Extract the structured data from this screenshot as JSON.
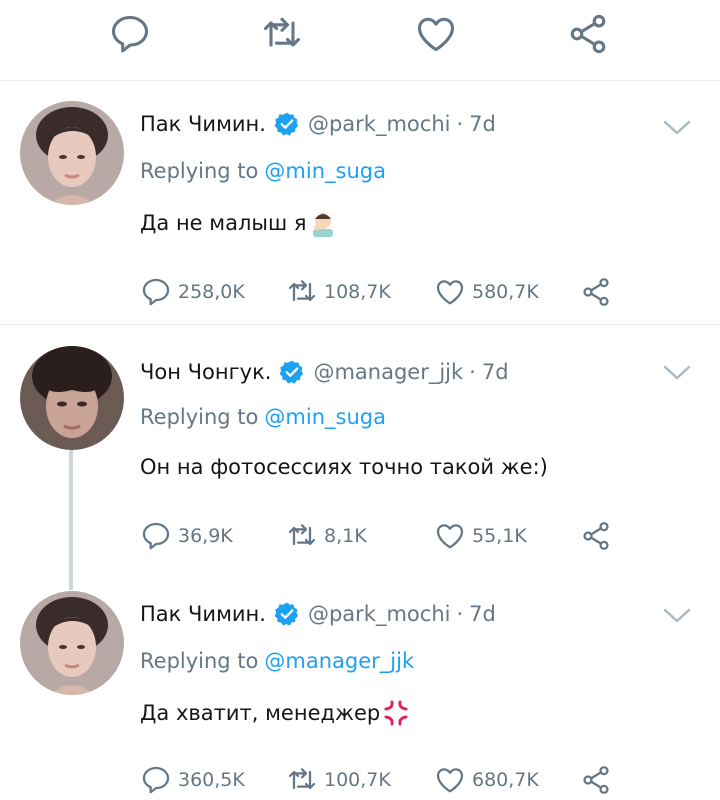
{
  "colors": {
    "accent": "#1da1f2",
    "icon": "#657786",
    "divider": "#e6ecf0",
    "thread": "#ccd6dd"
  },
  "top_actions": [
    "reply-icon",
    "retweet-icon",
    "like-icon",
    "share-icon"
  ],
  "tweets": [
    {
      "name": "Пак Чимин.",
      "handle": "@park_mochi",
      "separator": "·",
      "time": "7d",
      "replying_label": "Replying to",
      "replying_to": "@min_suga",
      "text": "Да не малыш я",
      "emoji": "facepalm-emoji",
      "replies": "258,0K",
      "retweets": "108,7K",
      "likes": "580,7K"
    },
    {
      "name": "Чон Чонгук.",
      "handle": "@manager_jjk",
      "separator": "·",
      "time": "7d",
      "replying_label": "Replying to",
      "replying_to": "@min_suga",
      "text": "Он на фотосессиях точно такой же:)",
      "replies": "36,9K",
      "retweets": "8,1K",
      "likes": "55,1K"
    },
    {
      "name": "Пак Чимин.",
      "handle": "@park_mochi",
      "separator": "·",
      "time": "7d",
      "replying_label": "Replying to",
      "replying_to": "@manager_jjk",
      "text": "Да хватит, менеджер",
      "emoji": "anger-emoji",
      "replies": "360,5K",
      "retweets": "100,7K",
      "likes": "680,7K"
    }
  ]
}
